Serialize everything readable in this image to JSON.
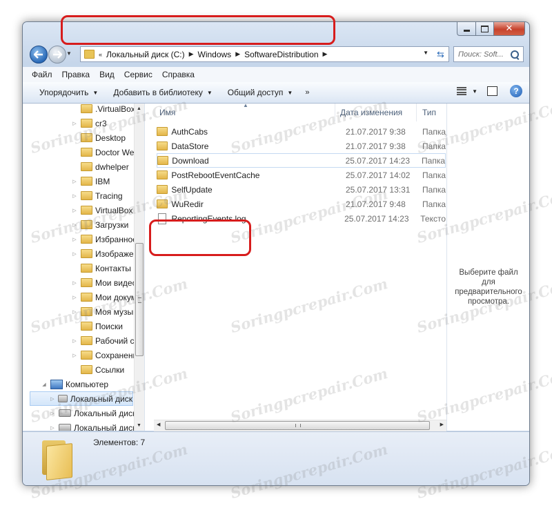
{
  "window": {
    "controls": {
      "minimize": "minimize",
      "maximize": "maximize",
      "close": "✕"
    }
  },
  "address": {
    "recent_glyph": "«",
    "crumbs": [
      "Локальный диск (C:)",
      "Windows",
      "SoftwareDistribution"
    ]
  },
  "search": {
    "placeholder": "Поиск: Soft..."
  },
  "menu": [
    "Файл",
    "Правка",
    "Вид",
    "Сервис",
    "Справка"
  ],
  "toolbar": {
    "organize": "Упорядочить",
    "add_library": "Добавить в библиотеку",
    "share": "Общий доступ",
    "more": "»"
  },
  "tree": [
    {
      "label": ".VirtualBox",
      "icon": "folder",
      "expander": false
    },
    {
      "label": "cr3",
      "icon": "folder",
      "expander": true
    },
    {
      "label": "Desktop",
      "icon": "folder",
      "expander": false
    },
    {
      "label": "Doctor Web",
      "icon": "folder",
      "expander": false
    },
    {
      "label": "dwhelper",
      "icon": "folder",
      "expander": false
    },
    {
      "label": "IBM",
      "icon": "folder",
      "expander": true
    },
    {
      "label": "Tracing",
      "icon": "folder",
      "expander": true
    },
    {
      "label": "VirtualBox VMs",
      "icon": "folder",
      "expander": true
    },
    {
      "label": "Загрузки",
      "icon": "folder",
      "expander": true
    },
    {
      "label": "Избранное",
      "icon": "folder",
      "expander": true
    },
    {
      "label": "Изображения",
      "icon": "folder",
      "expander": true
    },
    {
      "label": "Контакты",
      "icon": "folder",
      "expander": false
    },
    {
      "label": "Мои видеозапис",
      "icon": "folder",
      "expander": true
    },
    {
      "label": "Мои документы",
      "icon": "folder",
      "expander": true
    },
    {
      "label": "Моя музыка",
      "icon": "folder",
      "expander": true
    },
    {
      "label": "Поиски",
      "icon": "folder",
      "expander": false
    },
    {
      "label": "Рабочий стол",
      "icon": "folder",
      "expander": true
    },
    {
      "label": "Сохраненные игр",
      "icon": "folder",
      "expander": true
    },
    {
      "label": "Ссылки",
      "icon": "folder",
      "expander": false
    },
    {
      "label": "Компьютер",
      "icon": "computer",
      "expander": true,
      "expanded": true
    },
    {
      "label": "Локальный диск",
      "icon": "drive",
      "expander": true,
      "selected": true
    },
    {
      "label": "Локальный диск",
      "icon": "drive",
      "expander": true
    },
    {
      "label": "Локальный диск",
      "icon": "drive",
      "expander": true
    }
  ],
  "columns": {
    "name": "Имя",
    "date": "Дата изменения",
    "type": "Тип"
  },
  "files": [
    {
      "name": "AuthCabs",
      "date": "21.07.2017 9:38",
      "type": "Папка",
      "kind": "folder"
    },
    {
      "name": "DataStore",
      "date": "21.07.2017 9:38",
      "type": "Папка",
      "kind": "folder"
    },
    {
      "name": "Download",
      "date": "25.07.2017 14:23",
      "type": "Папка",
      "kind": "folder",
      "selected": true
    },
    {
      "name": "PostRebootEventCache",
      "date": "25.07.2017 14:02",
      "type": "Папка",
      "kind": "folder"
    },
    {
      "name": "SelfUpdate",
      "date": "25.07.2017 13:31",
      "type": "Папка",
      "kind": "folder"
    },
    {
      "name": "WuRedir",
      "date": "21.07.2017 9:48",
      "type": "Папка",
      "kind": "folder"
    },
    {
      "name": "ReportingEvents.log",
      "date": "25.07.2017 14:23",
      "type": "Тексто",
      "kind": "file"
    }
  ],
  "preview": {
    "text": "Выберите файл\nдля\nпредварительного\nпросмотра."
  },
  "details": {
    "items_count": "Элементов: 7"
  },
  "watermark": "Soringpcrepair.Com",
  "colors": {
    "highlight": "#d71c1c",
    "accent": "#2a6ab8"
  }
}
